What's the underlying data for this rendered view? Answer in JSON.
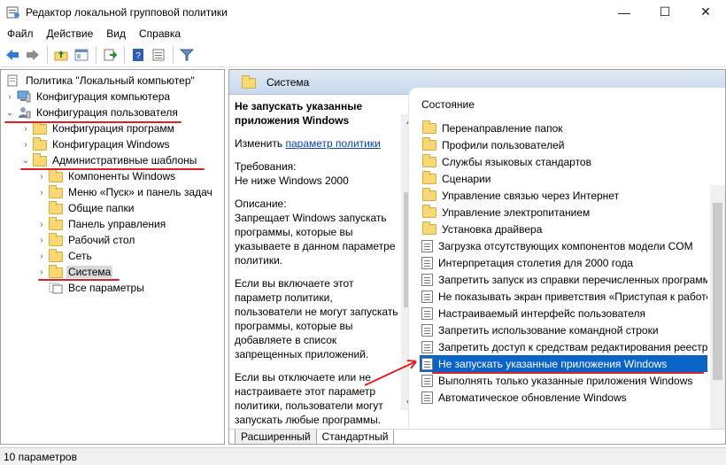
{
  "window": {
    "title": "Редактор локальной групповой политики",
    "controls": [
      "—",
      "☐",
      "✕"
    ]
  },
  "menu": [
    "Файл",
    "Действие",
    "Вид",
    "Справка"
  ],
  "toolbar": {
    "buttons": [
      "back-icon",
      "forward-icon",
      "up-folder-icon",
      "show-hide-tree-icon",
      "export-icon",
      "help-icon",
      "properties-icon",
      "filter-icon"
    ]
  },
  "tree": {
    "root": "Политика \"Локальный компьютер\"",
    "computer_config": "Конфигурация компьютера",
    "user_config": "Конфигурация пользователя",
    "software": "Конфигурация программ",
    "windows_config": "Конфигурация Windows",
    "admin_templates": "Административные шаблоны",
    "win_components": "Компоненты Windows",
    "start_menu": "Меню «Пуск» и панель задач",
    "shared_folders": "Общие папки",
    "control_panel": "Панель управления",
    "desktop": "Рабочий стол",
    "network": "Сеть",
    "system": "Система",
    "all_settings": "Все параметры"
  },
  "header": {
    "title": "Система"
  },
  "description": {
    "title": "Не запускать указанные приложения Windows",
    "edit_prefix": "Изменить",
    "edit_link": "параметр политики",
    "req_label": "Требования:",
    "req_value": "Не ниже Windows 2000",
    "desc_label": "Описание:",
    "desc_text": "Запрещает Windows запускать программы, которые вы указываете в данном параметре политики.",
    "enable_text": "Если вы включаете этот параметр политики, пользователи не могут запускать программы, которые вы добавляете в список запрещенных приложений.",
    "disable_text": "Если вы отключаете или не настраиваете этот параметр политики, пользователи могут запускать любые программы."
  },
  "list": {
    "header": "Состояние",
    "items": [
      {
        "label": "Перенаправление папок",
        "type": "folder"
      },
      {
        "label": "Профили пользователей",
        "type": "folder"
      },
      {
        "label": "Службы языковых стандартов",
        "type": "folder"
      },
      {
        "label": "Сценарии",
        "type": "folder"
      },
      {
        "label": "Управление связью через Интернет",
        "type": "folder"
      },
      {
        "label": "Управление электропитанием",
        "type": "folder"
      },
      {
        "label": "Установка драйвера",
        "type": "folder"
      },
      {
        "label": "Загрузка отсутствующих компонентов модели COM",
        "type": "setting"
      },
      {
        "label": "Интерпретация столетия для 2000 года",
        "type": "setting"
      },
      {
        "label": "Запретить запуск из справки перечисленных программ",
        "type": "setting"
      },
      {
        "label": "Не показывать экран приветствия «Приступая к работе»",
        "type": "setting"
      },
      {
        "label": "Настраиваемый интерфейс пользователя",
        "type": "setting"
      },
      {
        "label": "Запретить использование командной строки",
        "type": "setting"
      },
      {
        "label": "Запретить доступ к средствам редактирования реестра",
        "type": "setting"
      },
      {
        "label": "Не запускать указанные приложения Windows",
        "type": "setting",
        "selected": true
      },
      {
        "label": "Выполнять только указанные приложения Windows",
        "type": "setting"
      },
      {
        "label": "Автоматическое обновление Windows",
        "type": "setting"
      }
    ]
  },
  "tabs": [
    "Расширенный",
    "Стандартный"
  ],
  "status": "10 параметров",
  "colors": {
    "selection": "#0a64c8",
    "annotation": "#e02020",
    "header": "#dfe9f5"
  }
}
